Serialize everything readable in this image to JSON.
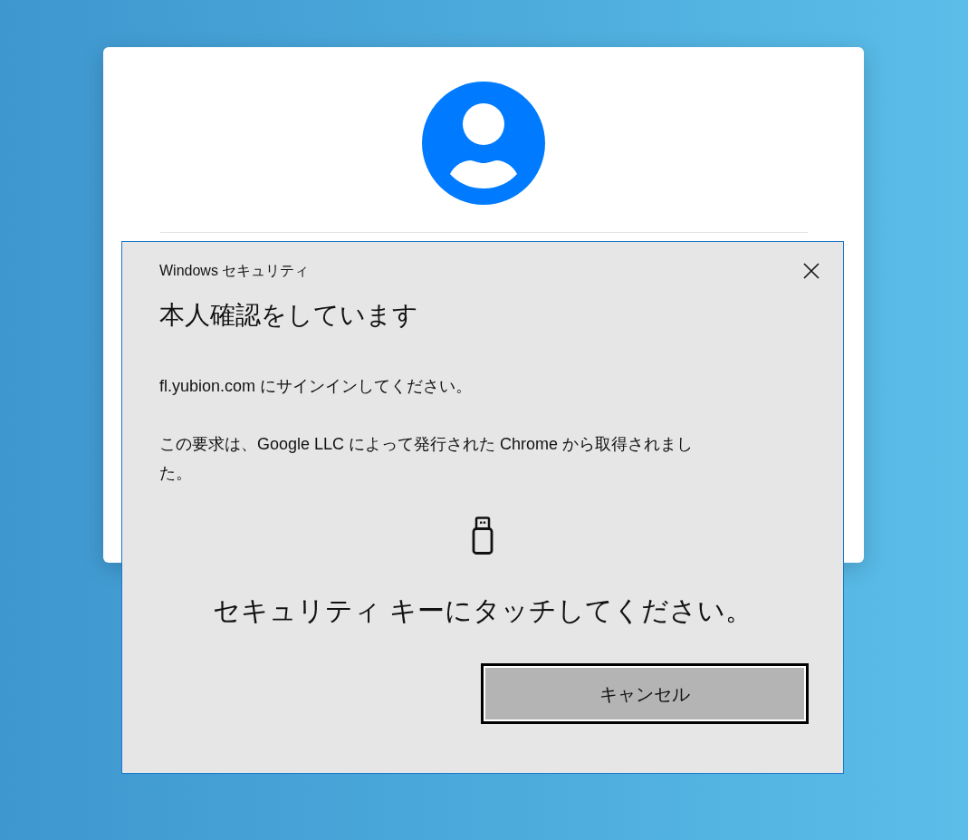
{
  "dialog": {
    "title": "Windows セキュリティ",
    "heading": "本人確認をしています",
    "messages": [
      "fl.yubion.com にサインインしてください。",
      "この要求は、Google LLC によって発行された Chrome から取得されました。"
    ],
    "prompt": "セキュリティ キーにタッチしてください。",
    "buttons": [
      {
        "label": "キャンセル",
        "focused": true
      }
    ]
  }
}
